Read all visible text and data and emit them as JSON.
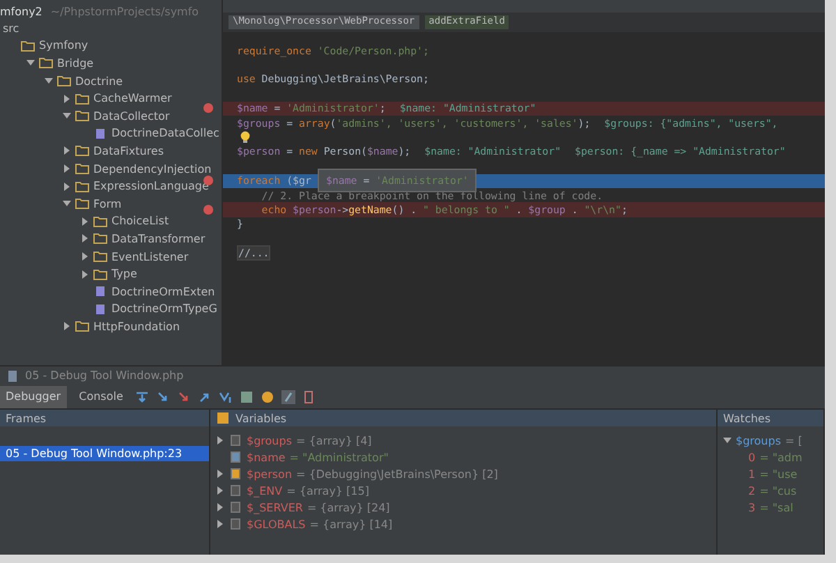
{
  "project": {
    "name": "mfony2",
    "path": "~/PhpstormProjects/symfo",
    "root": "src"
  },
  "tree": [
    {
      "label": "Symfony",
      "kind": "folder",
      "expanded": true,
      "children": [
        {
          "label": "Bridge",
          "kind": "folder",
          "expanded": true,
          "children": [
            {
              "label": "Doctrine",
              "kind": "folder",
              "expanded": true,
              "children": [
                {
                  "label": "CacheWarmer",
                  "kind": "folder",
                  "expanded": false
                },
                {
                  "label": "DataCollector",
                  "kind": "folder",
                  "expanded": true,
                  "children": [
                    {
                      "label": "DoctrineDataCollec",
                      "kind": "file"
                    }
                  ]
                },
                {
                  "label": "DataFixtures",
                  "kind": "folder",
                  "expanded": false
                },
                {
                  "label": "DependencyInjection",
                  "kind": "folder",
                  "expanded": false
                },
                {
                  "label": "ExpressionLanguage",
                  "kind": "folder",
                  "expanded": false
                },
                {
                  "label": "Form",
                  "kind": "folder",
                  "expanded": true,
                  "children": [
                    {
                      "label": "ChoiceList",
                      "kind": "folder",
                      "expanded": false
                    },
                    {
                      "label": "DataTransformer",
                      "kind": "folder",
                      "expanded": false
                    },
                    {
                      "label": "EventListener",
                      "kind": "folder",
                      "expanded": false
                    },
                    {
                      "label": "Type",
                      "kind": "folder",
                      "expanded": false
                    },
                    {
                      "label": "DoctrineOrmExten",
                      "kind": "file"
                    },
                    {
                      "label": "DoctrineOrmTypeG",
                      "kind": "file"
                    }
                  ]
                },
                {
                  "label": "HttpFoundation",
                  "kind": "folder",
                  "expanded": false
                }
              ]
            }
          ]
        }
      ]
    }
  ],
  "breadcrumbs": [
    {
      "label": "\\Monolog\\Processor\\WebProcessor",
      "kind": "class"
    },
    {
      "label": "addExtraField",
      "kind": "method"
    }
  ],
  "code_lines": [
    {
      "tokens": [
        {
          "text": "require_once",
          "kind": "keyword"
        },
        {
          "text": " 'Code/Person.php';",
          "kind": "string"
        }
      ],
      "breakpoint": false,
      "current": false,
      "bulb": false
    },
    {
      "breakpoint": false,
      "current": false,
      "bulb": false
    },
    {
      "tokens": [
        {
          "text": "use",
          "kind": "keyword"
        },
        {
          "text": " Debugging\\JetBrains\\Person;",
          "kind": "plain"
        }
      ],
      "breakpoint": false,
      "current": false,
      "bulb": false
    },
    {
      "breakpoint": false,
      "current": false,
      "bulb": false
    },
    {
      "tokens": [
        {
          "text": "$name",
          "kind": "variable"
        },
        {
          "text": " = ",
          "kind": "plain"
        },
        {
          "text": "'Administrator'",
          "kind": "string"
        },
        {
          "text": ";",
          "kind": "plain"
        }
      ],
      "hints": [
        "$name: \"Administrator\""
      ],
      "breakpoint": true,
      "current": false,
      "bulb": false
    },
    {
      "tokens": [
        {
          "text": "$groups",
          "kind": "variable"
        },
        {
          "text": " = ",
          "kind": "plain"
        },
        {
          "text": "array",
          "kind": "keyword"
        },
        {
          "text": "(",
          "kind": "plain"
        },
        {
          "text": "'admins', 'users', 'customers', 'sales'",
          "kind": "string"
        },
        {
          "text": ");",
          "kind": "plain"
        }
      ],
      "hints": [
        "$groups: {\"admins\", \"users\","
      ],
      "breakpoint": false,
      "current": false,
      "bulb": false
    },
    {
      "breakpoint": false,
      "current": false,
      "bulb": true
    },
    {
      "tokens": [
        {
          "text": "$person",
          "kind": "variable"
        },
        {
          "text": " = ",
          "kind": "plain"
        },
        {
          "text": "new",
          "kind": "keyword"
        },
        {
          "text": " Person(",
          "kind": "plain"
        },
        {
          "text": "$name",
          "kind": "variable"
        },
        {
          "text": ");",
          "kind": "plain"
        }
      ],
      "hints": [
        "$name: \"Administrator\"",
        "$person: {_name => \"Administrator\""
      ],
      "breakpoint": false,
      "current": false,
      "bulb": false
    },
    {
      "breakpoint": false,
      "current": false,
      "bulb": false
    },
    {
      "tokens": [
        {
          "text": "foreach",
          "kind": "keyword"
        },
        {
          "text": " ($gr",
          "kind": "plain"
        }
      ],
      "breakpoint": true,
      "current": true,
      "bulb": false,
      "tooltip": [
        {
          "text": "$name",
          "kind": "variable"
        },
        {
          "text": " = ",
          "kind": "plain"
        },
        {
          "text": "'Administrator'",
          "kind": "string"
        }
      ]
    },
    {
      "tokens": [
        {
          "text": "    // 2. Place a breakpoint on the following line of code.",
          "kind": "comment"
        }
      ],
      "breakpoint": false,
      "current": false,
      "bulb": false
    },
    {
      "tokens": [
        {
          "text": "    echo ",
          "kind": "keyword"
        },
        {
          "text": "$person",
          "kind": "variable"
        },
        {
          "text": "->",
          "kind": "plain"
        },
        {
          "text": "getName",
          "kind": "function"
        },
        {
          "text": "() . ",
          "kind": "plain"
        },
        {
          "text": "\" belongs to \"",
          "kind": "string"
        },
        {
          "text": " . ",
          "kind": "plain"
        },
        {
          "text": "$group",
          "kind": "variable"
        },
        {
          "text": " . ",
          "kind": "plain"
        },
        {
          "text": "\"\\r\\n\"",
          "kind": "string"
        },
        {
          "text": ";",
          "kind": "plain"
        }
      ],
      "breakpoint": true,
      "current": false,
      "bulb": false
    },
    {
      "tokens": [
        {
          "text": "}",
          "kind": "plain"
        }
      ],
      "breakpoint": false,
      "current": false,
      "bulb": false
    },
    {
      "breakpoint": false,
      "current": false,
      "bulb": false
    },
    {
      "tokens": [
        {
          "text": "//...",
          "kind": "fold"
        }
      ],
      "breakpoint": false,
      "current": false,
      "bulb": false
    }
  ],
  "debug_window": {
    "title": "05 - Debug Tool Window.php"
  },
  "debug_tabs": [
    {
      "label": "Debugger",
      "selected": true
    },
    {
      "label": "Console",
      "selected": false
    }
  ],
  "frames": {
    "title": "Frames",
    "items": [
      {
        "label": "05 - Debug Tool Window.php:23",
        "selected": true
      }
    ]
  },
  "variables": {
    "title": "Variables",
    "items": [
      {
        "name": "$groups",
        "value": "= {array} [4]",
        "expandable": true,
        "kind": "array"
      },
      {
        "name": "$name",
        "value": "= \"Administrator\"",
        "expandable": false,
        "kind": "string"
      },
      {
        "name": "$person",
        "value": "= {Debugging\\JetBrains\\Person} [2]",
        "expandable": true,
        "kind": "object"
      },
      {
        "name": "$_ENV",
        "value": "= {array} [15]",
        "expandable": true,
        "kind": "array"
      },
      {
        "name": "$_SERVER",
        "value": "= {array} [24]",
        "expandable": true,
        "kind": "array"
      },
      {
        "name": "$GLOBALS",
        "value": "= {array} [14]",
        "expandable": true,
        "kind": "array"
      }
    ]
  },
  "watches": {
    "title": "Watches",
    "items": [
      {
        "name": "$groups",
        "value": "= [",
        "expanded": true,
        "children": [
          {
            "name": "0",
            "value": "= \"adm"
          },
          {
            "name": "1",
            "value": "= \"use"
          },
          {
            "name": "2",
            "value": "= \"cus"
          },
          {
            "name": "3",
            "value": "= \"sal"
          }
        ]
      }
    ]
  }
}
